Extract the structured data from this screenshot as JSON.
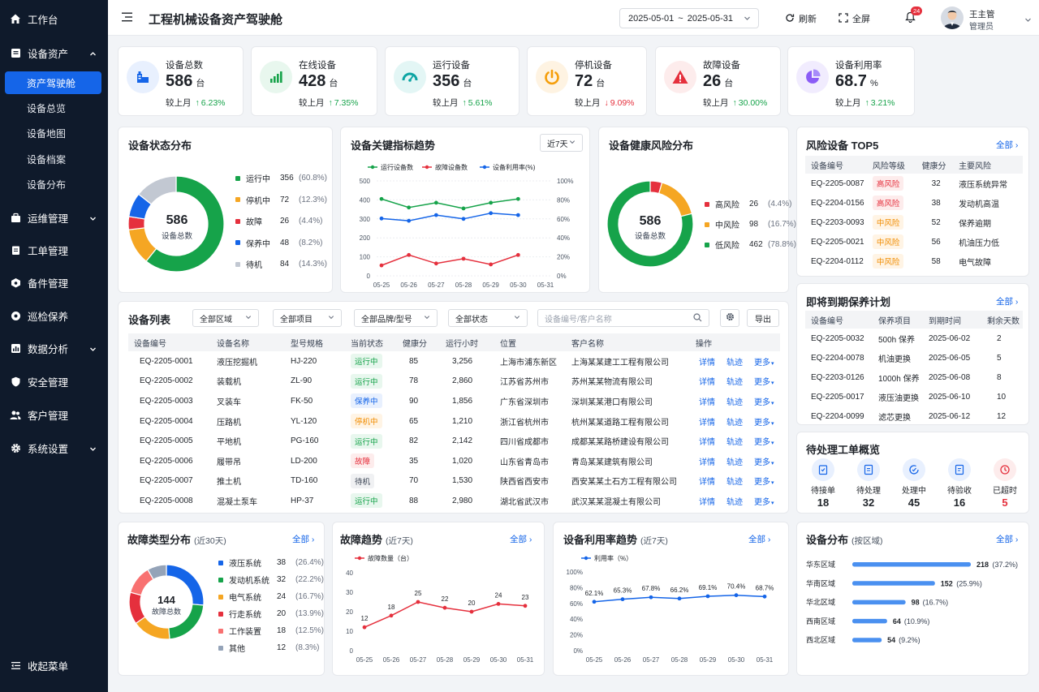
{
  "sidebar": {
    "items": [
      {
        "label": "工作台",
        "icon": "home-icon"
      },
      {
        "label": "设备资产",
        "icon": "asset-icon"
      },
      {
        "label": "运维管理",
        "icon": "ops-icon"
      },
      {
        "label": "工单管理",
        "icon": "workorder-icon"
      },
      {
        "label": "备件管理",
        "icon": "spare-parts-icon"
      },
      {
        "label": "巡检保养",
        "icon": "inspection-icon"
      },
      {
        "label": "数据分析",
        "icon": "chart-icon"
      },
      {
        "label": "安全管理",
        "icon": "shield-icon"
      },
      {
        "label": "客户管理",
        "icon": "users-icon"
      },
      {
        "label": "系统设置",
        "icon": "gear-icon"
      }
    ],
    "sub_items": [
      "资产驾驶舱",
      "设备总览",
      "设备地图",
      "设备档案",
      "设备分布"
    ],
    "collapse_label": "收起菜单"
  },
  "header": {
    "title": "工程机械设备资产驾驶舱",
    "date_start": "2025-05-01",
    "date_sep": "~",
    "date_end": "2025-05-31",
    "refresh_label": "刷新",
    "fullscreen_label": "全屏",
    "notification_count": "24",
    "user_name": "王主管",
    "user_role": "管理员"
  },
  "kpis": [
    {
      "label": "设备总数",
      "value": "586",
      "unit": "台",
      "cmp_label": "较上月",
      "arrow": "↑",
      "change": "6.23%",
      "dir": "up",
      "color": "#1565e8"
    },
    {
      "label": "在线设备",
      "value": "428",
      "unit": "台",
      "cmp_label": "较上月",
      "arrow": "↑",
      "change": "7.35%",
      "dir": "up",
      "color": "#16a34a"
    },
    {
      "label": "运行设备",
      "value": "356",
      "unit": "台",
      "cmp_label": "较上月",
      "arrow": "↑",
      "change": "5.61%",
      "dir": "up",
      "color": "#0ea5a4"
    },
    {
      "label": "停机设备",
      "value": "72",
      "unit": "台",
      "cmp_label": "较上月",
      "arrow": "↓",
      "change": "9.09%",
      "dir": "down",
      "color": "#f59e0b"
    },
    {
      "label": "故障设备",
      "value": "26",
      "unit": "台",
      "cmp_label": "较上月",
      "arrow": "↑",
      "change": "30.00%",
      "dir": "up",
      "color": "#e5303d"
    },
    {
      "label": "设备利用率",
      "value": "68.7",
      "unit": "%",
      "cmp_label": "较上月",
      "arrow": "↑",
      "change": "3.21%",
      "dir": "up",
      "color": "#8b5cf6"
    }
  ],
  "status_dist": {
    "title": "设备状态分布",
    "center_value": "586",
    "center_label": "设备总数",
    "items": [
      {
        "label": "运行中",
        "value": "356",
        "pct": "(60.8%)",
        "color": "#16a34a",
        "num": 356
      },
      {
        "label": "停机中",
        "value": "72",
        "pct": "(12.3%)",
        "color": "#f5a623",
        "num": 72
      },
      {
        "label": "故障",
        "value": "26",
        "pct": "(4.4%)",
        "color": "#e5303d",
        "num": 26
      },
      {
        "label": "保养中",
        "value": "48",
        "pct": "(8.2%)",
        "color": "#1565e8",
        "num": 48
      },
      {
        "label": "待机",
        "value": "84",
        "pct": "(14.3%)",
        "color": "#c2c8d2",
        "num": 84
      }
    ]
  },
  "trend": {
    "title": "设备关键指标趋势",
    "period": "近7天",
    "chart_data": {
      "type": "line",
      "x": [
        "05-25",
        "05-26",
        "05-27",
        "05-28",
        "05-29",
        "05-30",
        "05-31"
      ],
      "yticks_left": [
        "0",
        "100",
        "200",
        "300",
        "400",
        "500"
      ],
      "yticks_right": [
        "0%",
        "20%",
        "40%",
        "60%",
        "80%",
        "100%"
      ],
      "ylim": [
        0,
        500
      ],
      "series": [
        {
          "name": "运行设备数",
          "color": "#16a34a",
          "values": [
            405,
            360,
            385,
            355,
            385,
            405,
            null
          ]
        },
        {
          "name": "故障设备数",
          "color": "#e5303d",
          "values": [
            55,
            110,
            65,
            90,
            60,
            110,
            null
          ]
        },
        {
          "name": "设备利用率(%)",
          "color": "#1565e8",
          "values": [
            302,
            290,
            320,
            300,
            330,
            320,
            null
          ]
        }
      ]
    }
  },
  "health": {
    "title": "设备健康风险分布",
    "center_value": "586",
    "center_label": "设备总数",
    "items": [
      {
        "label": "高风险",
        "value": "26",
        "pct": "(4.4%)",
        "color": "#e5303d",
        "num": 26
      },
      {
        "label": "中风险",
        "value": "98",
        "pct": "(16.7%)",
        "color": "#f5a623",
        "num": 98
      },
      {
        "label": "低风险",
        "value": "462",
        "pct": "(78.8%)",
        "color": "#16a34a",
        "num": 462
      }
    ]
  },
  "risk_top5": {
    "title": "风险设备 TOP5",
    "more": "全部",
    "headers": [
      "设备编号",
      "风险等级",
      "健康分",
      "主要风险"
    ],
    "rows": [
      {
        "id": "EQ-2205-0087",
        "level": "高风险",
        "lvl": "red",
        "score": "32",
        "risk": "液压系统异常"
      },
      {
        "id": "EQ-2204-0156",
        "level": "高风险",
        "lvl": "red",
        "score": "38",
        "risk": "发动机高温"
      },
      {
        "id": "EQ-2203-0093",
        "level": "中风险",
        "lvl": "orange",
        "score": "52",
        "risk": "保养逾期"
      },
      {
        "id": "EQ-2205-0021",
        "level": "中风险",
        "lvl": "orange",
        "score": "56",
        "risk": "机油压力低"
      },
      {
        "id": "EQ-2204-0112",
        "level": "中风险",
        "lvl": "orange",
        "score": "58",
        "risk": "电气故障"
      }
    ]
  },
  "device_list": {
    "title": "设备列表",
    "filters": [
      "全部区域",
      "全部项目",
      "全部品牌/型号",
      "全部状态"
    ],
    "search_placeholder": "设备编号/客户名称",
    "export_label": "导出",
    "headers": [
      "设备编号",
      "设备名称",
      "型号规格",
      "当前状态",
      "健康分",
      "运行小时",
      "位置",
      "客户名称",
      "操作"
    ],
    "action_detail": "详情",
    "action_track": "轨迹",
    "action_more": "更多",
    "rows": [
      {
        "id": "EQ-2205-0001",
        "name": "液压挖掘机",
        "model": "HJ-220",
        "status": "运行中",
        "st": "green",
        "score": "85",
        "hours": "3,256",
        "loc": "上海市浦东新区",
        "customer": "上海某某建工工程有限公司"
      },
      {
        "id": "EQ-2205-0002",
        "name": "装载机",
        "model": "ZL-90",
        "status": "运行中",
        "st": "green",
        "score": "78",
        "hours": "2,860",
        "loc": "江苏省苏州市",
        "customer": "苏州某某物流有限公司"
      },
      {
        "id": "EQ-2205-0003",
        "name": "叉装车",
        "model": "FK-50",
        "status": "保养中",
        "st": "blue",
        "score": "90",
        "hours": "1,856",
        "loc": "广东省深圳市",
        "customer": "深圳某某港口有限公司"
      },
      {
        "id": "EQ-2205-0004",
        "name": "压路机",
        "model": "YL-120",
        "status": "停机中",
        "st": "orange",
        "score": "65",
        "hours": "1,210",
        "loc": "浙江省杭州市",
        "customer": "杭州某某道路工程有限公司"
      },
      {
        "id": "EQ-2205-0005",
        "name": "平地机",
        "model": "PG-160",
        "status": "运行中",
        "st": "green",
        "score": "82",
        "hours": "2,142",
        "loc": "四川省成都市",
        "customer": "成都某某路桥建设有限公司"
      },
      {
        "id": "EQ-2205-0006",
        "name": "履带吊",
        "model": "LD-200",
        "status": "故障",
        "st": "red",
        "score": "35",
        "hours": "1,020",
        "loc": "山东省青岛市",
        "customer": "青岛某某建筑有限公司"
      },
      {
        "id": "EQ-2205-0007",
        "name": "推土机",
        "model": "TD-160",
        "status": "待机",
        "st": "gray",
        "score": "70",
        "hours": "1,530",
        "loc": "陕西省西安市",
        "customer": "西安某某土石方工程有限公司"
      },
      {
        "id": "EQ-2205-0008",
        "name": "混凝土泵车",
        "model": "HP-37",
        "status": "运行中",
        "st": "green",
        "score": "88",
        "hours": "2,980",
        "loc": "湖北省武汉市",
        "customer": "武汉某某混凝土有限公司"
      }
    ]
  },
  "maintenance": {
    "title": "即将到期保养计划",
    "more": "全部",
    "headers": [
      "设备编号",
      "保养项目",
      "到期时间",
      "剩余天数"
    ],
    "rows": [
      {
        "id": "EQ-2205-0032",
        "item": "500h 保养",
        "date": "2025-06-02",
        "days": "2"
      },
      {
        "id": "EQ-2204-0078",
        "item": "机油更换",
        "date": "2025-06-05",
        "days": "5"
      },
      {
        "id": "EQ-2203-0126",
        "item": "1000h 保养",
        "date": "2025-06-08",
        "days": "8"
      },
      {
        "id": "EQ-2205-0017",
        "item": "液压油更换",
        "date": "2025-06-10",
        "days": "10"
      },
      {
        "id": "EQ-2204-0099",
        "item": "滤芯更换",
        "date": "2025-06-12",
        "days": "12"
      }
    ]
  },
  "workorders": {
    "title": "待处理工单概览",
    "items": [
      {
        "label": "待接单",
        "value": "18",
        "color": "#1565e8",
        "icon": "clipboard-icon"
      },
      {
        "label": "待处理",
        "value": "32",
        "color": "#1565e8",
        "icon": "document-icon"
      },
      {
        "label": "处理中",
        "value": "45",
        "color": "#1565e8",
        "icon": "progress-icon"
      },
      {
        "label": "待验收",
        "value": "16",
        "color": "#1565e8",
        "icon": "check-doc-icon"
      },
      {
        "label": "已超时",
        "value": "5",
        "color": "#e5303d",
        "icon": "clock-icon"
      }
    ]
  },
  "fault_types": {
    "title": "故障类型分布",
    "subtitle": "(近30天)",
    "more": "全部",
    "center_value": "144",
    "center_label": "故障总数",
    "items": [
      {
        "label": "液压系统",
        "value": "38",
        "pct": "(26.4%)",
        "color": "#1565e8",
        "num": 38
      },
      {
        "label": "发动机系统",
        "value": "32",
        "pct": "(22.2%)",
        "color": "#16a34a",
        "num": 32
      },
      {
        "label": "电气系统",
        "value": "24",
        "pct": "(16.7%)",
        "color": "#f5a623",
        "num": 24
      },
      {
        "label": "行走系统",
        "value": "20",
        "pct": "(13.9%)",
        "color": "#e5303d",
        "num": 20
      },
      {
        "label": "工作装置",
        "value": "18",
        "pct": "(12.5%)",
        "color": "#f87171",
        "num": 18
      },
      {
        "label": "其他",
        "value": "12",
        "pct": "(8.3%)",
        "color": "#94a3b8",
        "num": 12
      }
    ]
  },
  "fault_trend": {
    "title": "故障趋势",
    "subtitle": "(近7天)",
    "more": "全部",
    "chart_data": {
      "type": "line",
      "x": [
        "05-25",
        "05-26",
        "05-27",
        "05-28",
        "05-29",
        "05-30",
        "05-31"
      ],
      "yticks": [
        "0",
        "10",
        "20",
        "30",
        "40"
      ],
      "ylim": [
        0,
        40
      ],
      "series": [
        {
          "name": "故障数量（台）",
          "color": "#e5303d",
          "values": [
            12,
            18,
            25,
            22,
            20,
            24,
            23
          ]
        }
      ]
    }
  },
  "util_trend": {
    "title": "设备利用率趋势",
    "subtitle": "(近7天)",
    "more": "全部",
    "chart_data": {
      "type": "line",
      "x": [
        "05-25",
        "05-26",
        "05-27",
        "05-28",
        "05-29",
        "05-30",
        "05-31"
      ],
      "yticks": [
        "0%",
        "20%",
        "40%",
        "60%",
        "80%",
        "100%"
      ],
      "ylim": [
        0,
        100
      ],
      "series": [
        {
          "name": "利用率（%）",
          "color": "#1565e8",
          "values": [
            62.1,
            65.3,
            67.8,
            66.2,
            69.1,
            70.4,
            68.7
          ],
          "labels": [
            "62.1%",
            "65.3%",
            "67.8%",
            "66.2%",
            "69.1%",
            "70.4%",
            "68.7%"
          ]
        }
      ]
    }
  },
  "region_dist": {
    "title": "设备分布",
    "subtitle": "(按区域)",
    "more": "全部",
    "chart_data": {
      "type": "bar",
      "categories": [
        "华东区域",
        "华南区域",
        "华北区域",
        "西南区域",
        "西北区域"
      ],
      "values": [
        218,
        152,
        98,
        64,
        54
      ],
      "value_labels": [
        "218",
        "152",
        "98",
        "64",
        "54"
      ],
      "pct_labels": [
        "(37.2%)",
        "(25.9%)",
        "(16.7%)",
        "(10.9%)",
        "(9.2%)"
      ],
      "color": "#4a90f0"
    }
  }
}
